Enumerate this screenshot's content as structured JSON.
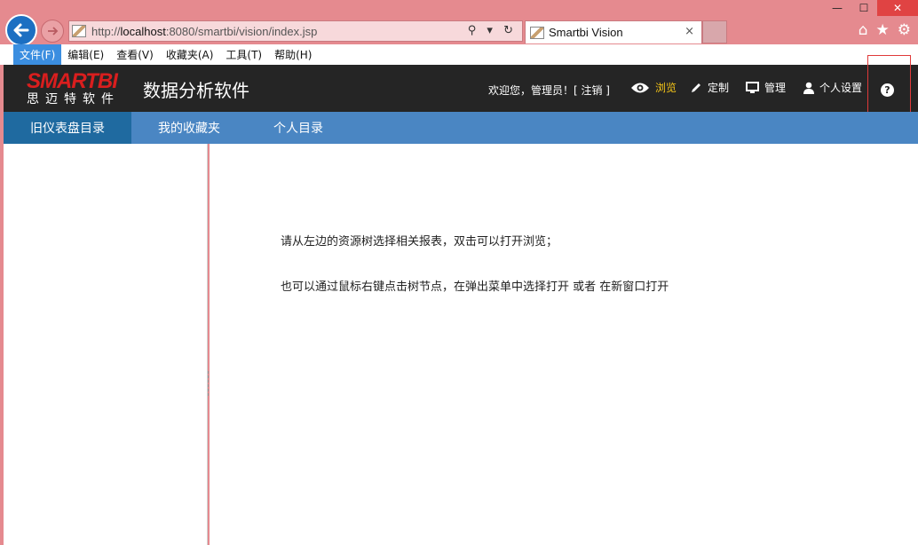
{
  "browser": {
    "url_prefix": "http://",
    "url_host": "localhost",
    "url_rest": ":8080/smartbi/vision/index.jsp",
    "tab_title": "Smartbi Vision",
    "tab_close": "×",
    "address_tools": "⚲ ▾ ↻"
  },
  "menu": [
    {
      "label": "文件(F)"
    },
    {
      "label": "编辑(E)"
    },
    {
      "label": "查看(V)"
    },
    {
      "label": "收藏夹(A)"
    },
    {
      "label": "工具(T)"
    },
    {
      "label": "帮助(H)"
    }
  ],
  "header": {
    "logo_brand": "SMARTBI",
    "logo_sub": "思迈特软件",
    "app_title": "数据分析软件",
    "welcome": "欢迎您，管理员！[ 注销 ]",
    "nav": {
      "browse": "浏览",
      "custom": "定制",
      "manage": "管理",
      "personal": "个人设置"
    },
    "help": "?"
  },
  "tabs": [
    {
      "label": "旧仪表盘目录"
    },
    {
      "label": "我的收藏夹"
    },
    {
      "label": "个人目录"
    }
  ],
  "main": {
    "line1": "请从左边的资源树选择相关报表，双击可以打开浏览；",
    "line2": "也可以通过鼠标右键点击树节点，在弹出菜单中选择打开 或者 在新窗口打开"
  },
  "colors": {
    "chrome": "#e58a8f",
    "header": "#252525",
    "tabbar": "#4a86c3",
    "active_tab": "#1f6aa0",
    "brand_red": "#d91e1e",
    "browse_active": "#f5c518"
  }
}
